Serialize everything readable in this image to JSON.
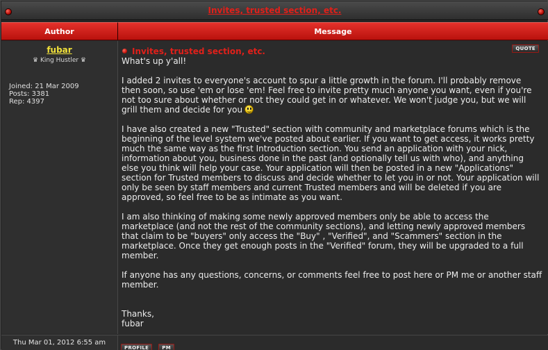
{
  "topic": {
    "title": "Invites, trusted section, etc."
  },
  "columns": {
    "author": "Author",
    "message": "Message"
  },
  "author": {
    "name": "fubar",
    "rank": "♛ King Hustler ♛",
    "joined": "Joined: 21 Mar 2009",
    "posts": "Posts: 3381",
    "rep": "Rep: 4397"
  },
  "post": {
    "title": "Invites, trusted section, etc.",
    "quote_label": "QUOTE",
    "greeting": "What's up y'all!",
    "p1": "I added 2 invites to everyone's account to spur a little growth in the forum. I'll probably remove then soon, so use 'em or lose 'em! Feel free to invite pretty much anyone you want, even if you're not too sure about whether or not they could get in or whatever. We won't judge you, but we will grill them and decide for you",
    "p2": "I have also created a new \"Trusted\" section with community and marketplace forums which is the beginning of the level system we've posted about earlier. If you want to get access, it works pretty much the same way as the first Introduction section. You send an application with your nick, information about you, business done in the past (and optionally tell us with who), and anything else you think will help your case. Your application will then be posted in a new \"Applications\" section for Trusted members to discuss and decide whether to let you in or not. Your application will only be seen by staff members and current Trusted members and will be deleted if you are approved, so feel free to be as intimate as you want.",
    "p3": "I am also thinking of making some newly approved members only be able to access the marketplace (and not the rest of the community sections), and letting newly approved members that claim to be \"buyers\" only access the \"Buy\" , \"Verified\", and \"Scammers\" section in the marketplace. Once they get enough posts in the \"Verified\" forum, they will be upgraded to a full member.",
    "p4": "If anyone has any questions, concerns, or comments feel free to post here or PM me or another staff member.",
    "sign_thanks": "Thanks,",
    "sign_name": "fubar",
    "smiley_icon": "smiley-icon"
  },
  "footer": {
    "date": "Thu Mar 01, 2012 6:55 am",
    "profile_label": "PROFILE",
    "pm_label": "PM"
  }
}
